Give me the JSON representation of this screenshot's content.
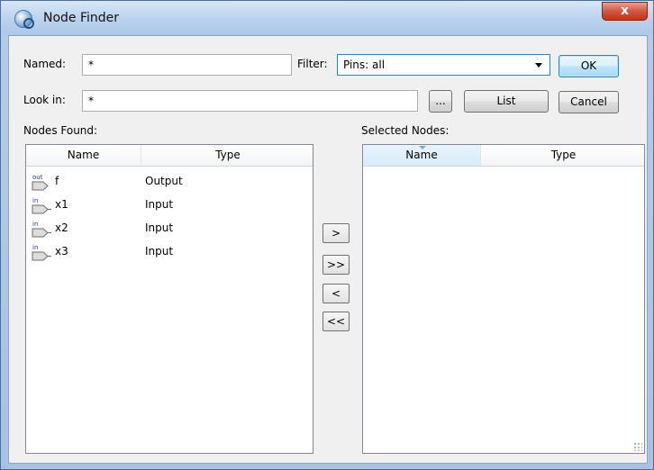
{
  "window": {
    "title": "Node Finder",
    "close_glyph": "x"
  },
  "form": {
    "named_label": "Named:",
    "named_value": "*",
    "filter_label": "Filter:",
    "filter_value": "Pins: all",
    "lookin_label": "Look in:",
    "lookin_value": "*",
    "browse_label": "...",
    "list_label": "List",
    "ok_label": "OK",
    "cancel_label": "Cancel"
  },
  "found": {
    "label": "Nodes Found:",
    "columns": [
      "Name",
      "Type"
    ],
    "rows": [
      {
        "pin_dir": "out",
        "name": "f",
        "type": "Output"
      },
      {
        "pin_dir": "in",
        "name": "x1",
        "type": "Input"
      },
      {
        "pin_dir": "in",
        "name": "x2",
        "type": "Input"
      },
      {
        "pin_dir": "in",
        "name": "x3",
        "type": "Input"
      }
    ]
  },
  "selected": {
    "label": "Selected Nodes:",
    "columns": [
      "Name",
      "Type"
    ],
    "rows": []
  },
  "move_buttons": [
    ">",
    ">>",
    "<",
    "<<"
  ],
  "colors": {
    "titlebar": "#bcd3ee",
    "accent": "#3c7fb1",
    "close": "#c2331c"
  },
  "icons": {
    "title": "node-finder-icon",
    "pin_out": "output-pin-icon",
    "pin_in": "input-pin-icon"
  }
}
